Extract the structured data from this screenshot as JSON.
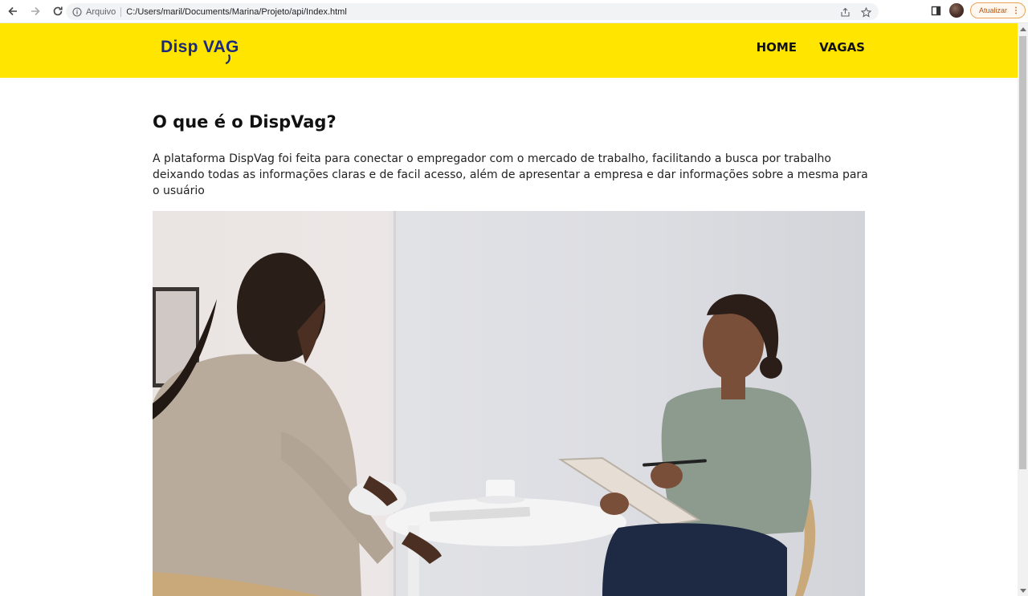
{
  "browser": {
    "scheme_label": "Arquivo",
    "url": "C:/Users/maril/Documents/Marina/Projeto/api/Index.html",
    "update_button": "Atualizar",
    "icons": [
      "back-arrow-icon",
      "forward-arrow-icon",
      "reload-icon",
      "info-icon",
      "share-icon",
      "star-icon",
      "side-panel-icon",
      "profile-avatar",
      "kebab-menu-icon"
    ]
  },
  "site": {
    "logo_text": "Disp VAG",
    "nav": [
      {
        "label": "HOME"
      },
      {
        "label": "VAGAS"
      }
    ],
    "colors": {
      "header_bg": "#ffe500",
      "logo_color": "#1c2a7a",
      "nav_color": "#111111"
    }
  },
  "main": {
    "title": "O que é o DispVag?",
    "intro": "A plataforma DispVag foi feita para conectar o empregador com o mercado de trabalho, facilitando a busca por trabalho deixando todas as informações claras e de facil acesso, além de apresentar a empresa e dar informações sobre a mesma para o usuário"
  }
}
